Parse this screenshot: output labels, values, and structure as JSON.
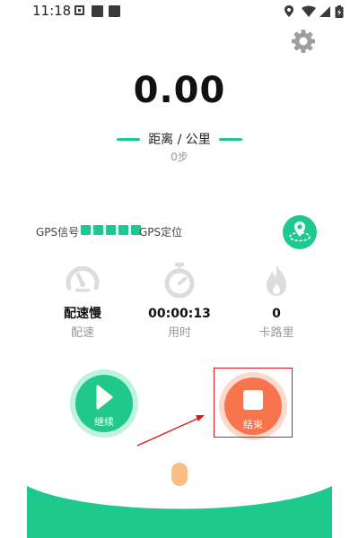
{
  "status_bar": {
    "time": "11:18",
    "icons": [
      "location-icon",
      "wifi-icon",
      "signal-icon",
      "battery-icon"
    ]
  },
  "header": {
    "settings_icon": "gear-icon"
  },
  "distance": {
    "value": "0.00",
    "unit": "距离 / 公里"
  },
  "steps": "0步",
  "gps": {
    "label": "GPS信号",
    "bars": 5,
    "status": "GPS定位",
    "map_icon": "map-location-icon"
  },
  "stats": [
    {
      "value": "配速慢",
      "label": "配速",
      "icon": "speedometer-icon"
    },
    {
      "value": "00:00:13",
      "label": "用时",
      "icon": "stopwatch-icon"
    },
    {
      "value": "0",
      "label": "卡路里",
      "icon": "flame-icon"
    }
  ],
  "controls": {
    "resume_label": "继续",
    "stop_label": "结束"
  },
  "colors": {
    "accent": "#1ec98e",
    "stop": "#f7744d",
    "stop_ring": "#fcd9cd",
    "resume_ring": "#bff2df",
    "highlight": "#e01a1a",
    "handle": "#f9be83"
  }
}
